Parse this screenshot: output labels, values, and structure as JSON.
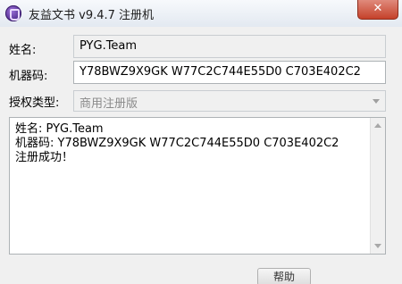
{
  "window": {
    "title": "友益文书 v9.4.7 注册机",
    "close_label": "✕"
  },
  "form": {
    "name_label": "姓名:",
    "name_value": "PYG.Team",
    "machine_label": "机器码:",
    "machine_value": "Y78BWZ9X9GK W77C2C744E55D0 C703E402C2",
    "license_label": "授权类型:",
    "license_value": "商用注册版"
  },
  "output": {
    "lines": [
      "姓名: PYG.Team",
      "机器码: Y78BWZ9X9GK W77C2C744E55D0 C703E402C2",
      "注册成功！"
    ]
  },
  "bottom": {
    "button_label": "帮助"
  }
}
